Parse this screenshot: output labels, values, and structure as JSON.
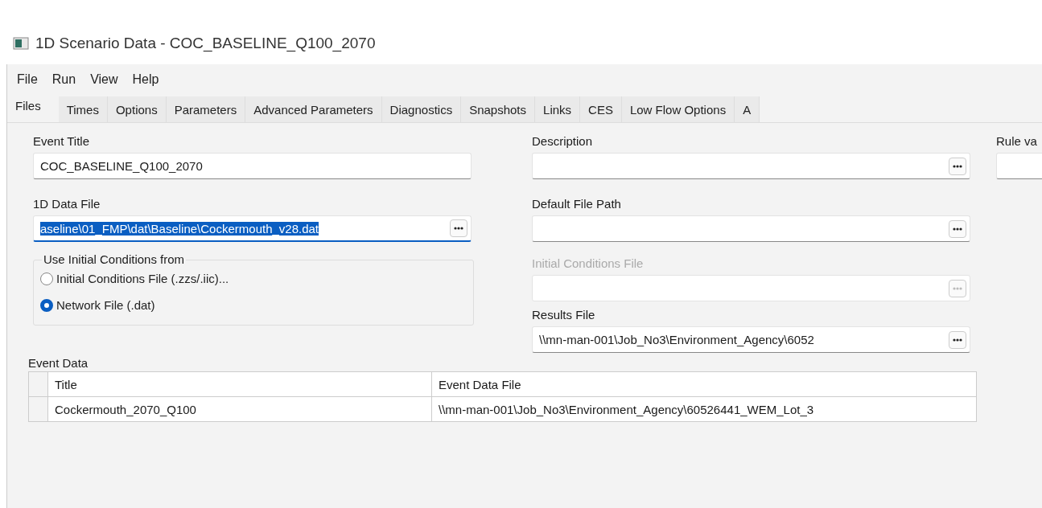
{
  "window": {
    "title": "1D Scenario Data - COC_BASELINE_Q100_2070"
  },
  "menu": [
    "File",
    "Run",
    "View",
    "Help"
  ],
  "tabs": [
    {
      "label": "Files",
      "selected": true
    },
    {
      "label": "Times",
      "selected": false
    },
    {
      "label": "Options",
      "selected": false
    },
    {
      "label": "Parameters",
      "selected": false
    },
    {
      "label": "Advanced Parameters",
      "selected": false
    },
    {
      "label": "Diagnostics",
      "selected": false
    },
    {
      "label": "Snapshots",
      "selected": false
    },
    {
      "label": "Links",
      "selected": false
    },
    {
      "label": "CES",
      "selected": false
    },
    {
      "label": "Low Flow Options",
      "selected": false
    },
    {
      "label": "A",
      "selected": false
    }
  ],
  "event_title": {
    "label": "Event Title",
    "value": "COC_BASELINE_Q100_2070"
  },
  "description": {
    "label": "Description",
    "disabled": false
  },
  "rule": {
    "label": "Rule va"
  },
  "data_file": {
    "label": "1D Data File",
    "value": "aseline\\01_FMP\\dat\\Baseline\\Cockermouth_v28.dat",
    "text_selected": true,
    "disabled": false
  },
  "default_path": {
    "label": "Default File Path",
    "disabled": false
  },
  "initial_conditions": {
    "title": "Use Initial Conditions from",
    "options": [
      {
        "label": "Initial Conditions File (.zzs/.iic)...",
        "selected": false
      },
      {
        "label": "Network File (.dat)",
        "selected": true
      }
    ]
  },
  "ic_file": {
    "label": "Initial Conditions File",
    "disabled": true
  },
  "results_file": {
    "label": "Results File",
    "value": "\\\\mn-man-001\\Job_No3\\Environment_Agency\\6052",
    "disabled": false
  },
  "event_data": {
    "label": "Event Data",
    "columns": [
      "Title",
      "Event Data File"
    ],
    "rows": [
      [
        "Cockermouth_2070_Q100",
        "\\\\mn-man-001\\Job_No3\\Environment_Agency\\60526441_WEM_Lot_3"
      ]
    ]
  }
}
